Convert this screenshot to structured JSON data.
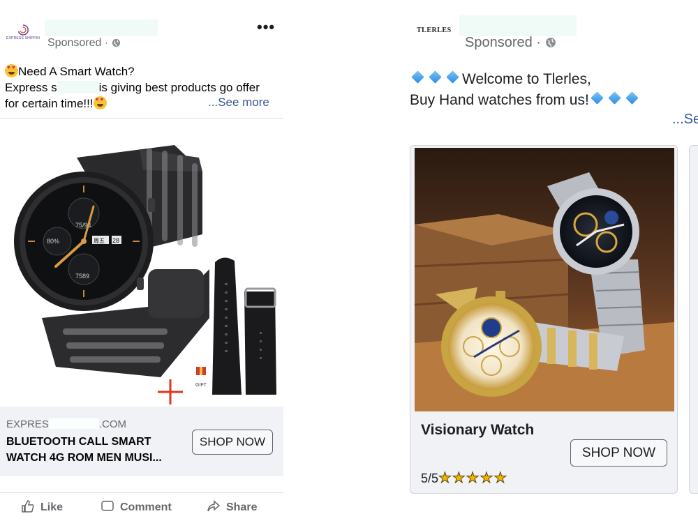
{
  "left_ad": {
    "logo_text": "EXPRESS SHIPPIN",
    "sponsored": "Sponsored ·",
    "more_menu": "•••",
    "body_line1": "Need A Smart Watch?",
    "body_line2a": "Express s",
    "body_line2b": "is giving best products go offer",
    "body_line3": "for certain time!!!",
    "see_more": "...See more",
    "image_gift_label": "GIFT",
    "watch_readouts": [
      "75/94",
      "80%",
      "7589",
      "周五",
      "28"
    ],
    "domain_prefix": "EXPRES",
    "domain_suffix": ".COM",
    "product_title": "BLUETOOTH CALL SMART WATCH 4G ROM MEN MUSI...",
    "shop_now": "SHOP NOW",
    "actions": {
      "like": "Like",
      "comment": "Comment",
      "share": "Share"
    }
  },
  "right_ad": {
    "logo_text": "TLERLES",
    "sponsored": "Sponsored ·",
    "body_line1": "Welcome to Tlerles,",
    "body_line2": "Buy Hand watches from us!",
    "see_more": "...Se",
    "card": {
      "title": "Visionary Watch",
      "shop_now": "SHOP NOW",
      "rating_text": "5/5",
      "stars": "★★★★★",
      "rating_value": 5
    }
  },
  "colors": {
    "link": "#385898",
    "secondary_text": "#65676b",
    "footer_bg": "#f0f2f5",
    "gift_plus": "#e0341f",
    "star": "#f5b400"
  }
}
